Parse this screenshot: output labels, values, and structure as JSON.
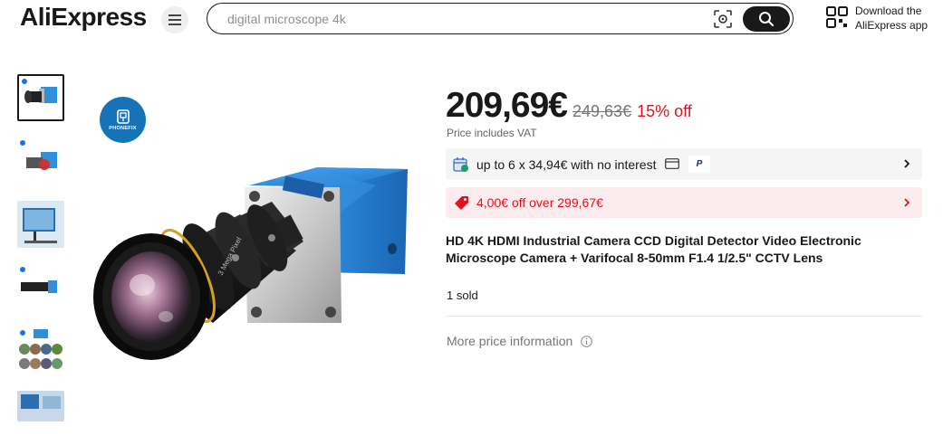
{
  "header": {
    "logo": "AliExpress",
    "search": {
      "placeholder": "digital microscope 4k"
    },
    "app_download": {
      "line1": "Download the",
      "line2": "AliExpress app"
    }
  },
  "gallery": {
    "thumbnails": [
      {
        "name": "camera-front",
        "active": true
      },
      {
        "name": "camera-angle",
        "active": false
      },
      {
        "name": "microscope-setup",
        "active": false
      },
      {
        "name": "camera-lens-side",
        "active": false
      },
      {
        "name": "sample-images",
        "active": false
      },
      {
        "name": "usage-scene",
        "active": false
      }
    ],
    "watermark": "PHONEFIX"
  },
  "product": {
    "price_now": "209,69€",
    "price_old": "249,63€",
    "discount": "15% off",
    "vat_note": "Price includes VAT",
    "installment": "up to 6 x 34,94€ with no interest",
    "coupon": "4,00€ off over 299,67€",
    "title": "HD 4K HDMI Industrial Camera CCD Digital Detector Video Electronic Microscope Camera + Varifocal 8-50mm F1.4 1/2.5\" CCTV Lens",
    "sold": "1 sold",
    "more_price": "More price information"
  },
  "colors": {
    "accent_red": "#e0131d",
    "text": "#191919",
    "muted": "#757575"
  }
}
